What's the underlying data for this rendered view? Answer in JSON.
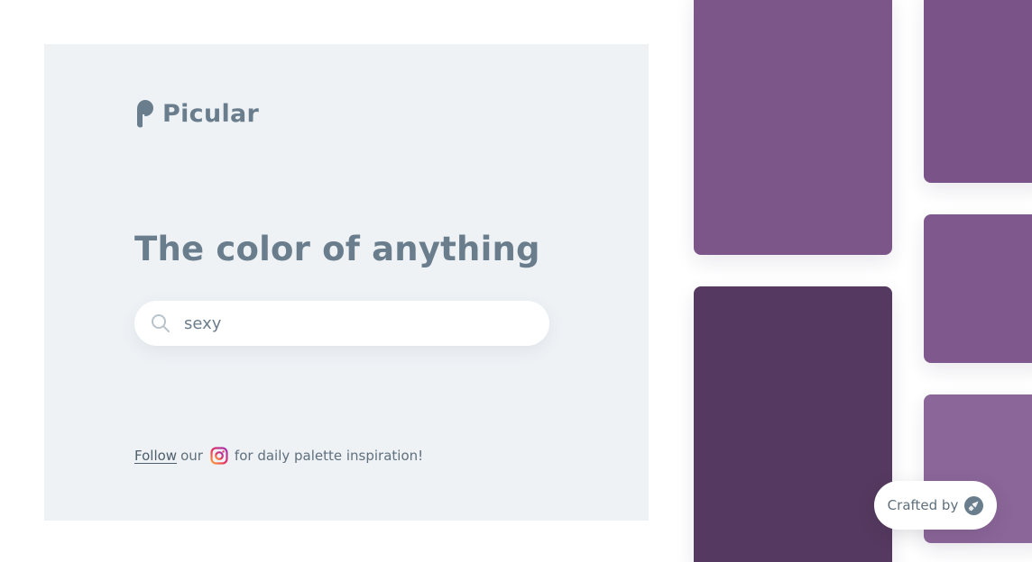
{
  "brand": {
    "name": "Picular",
    "color": "#6a7d8d"
  },
  "hero": {
    "headline": "The color of anything"
  },
  "search": {
    "value": "sexy",
    "icon": "search-icon"
  },
  "follow": {
    "link_label": "Follow",
    "middle_text": "our",
    "icon": "instagram-icon",
    "suffix_text": "for daily palette inspiration!"
  },
  "palette": {
    "swatches": [
      {
        "color": "#7c5589"
      },
      {
        "color": "#7a5488"
      },
      {
        "color": "#553960"
      },
      {
        "color": "#7f598d"
      },
      {
        "color": "#8b6699"
      }
    ]
  },
  "footer_badge": {
    "label": "Crafted by",
    "icon": "rocket-icon"
  }
}
